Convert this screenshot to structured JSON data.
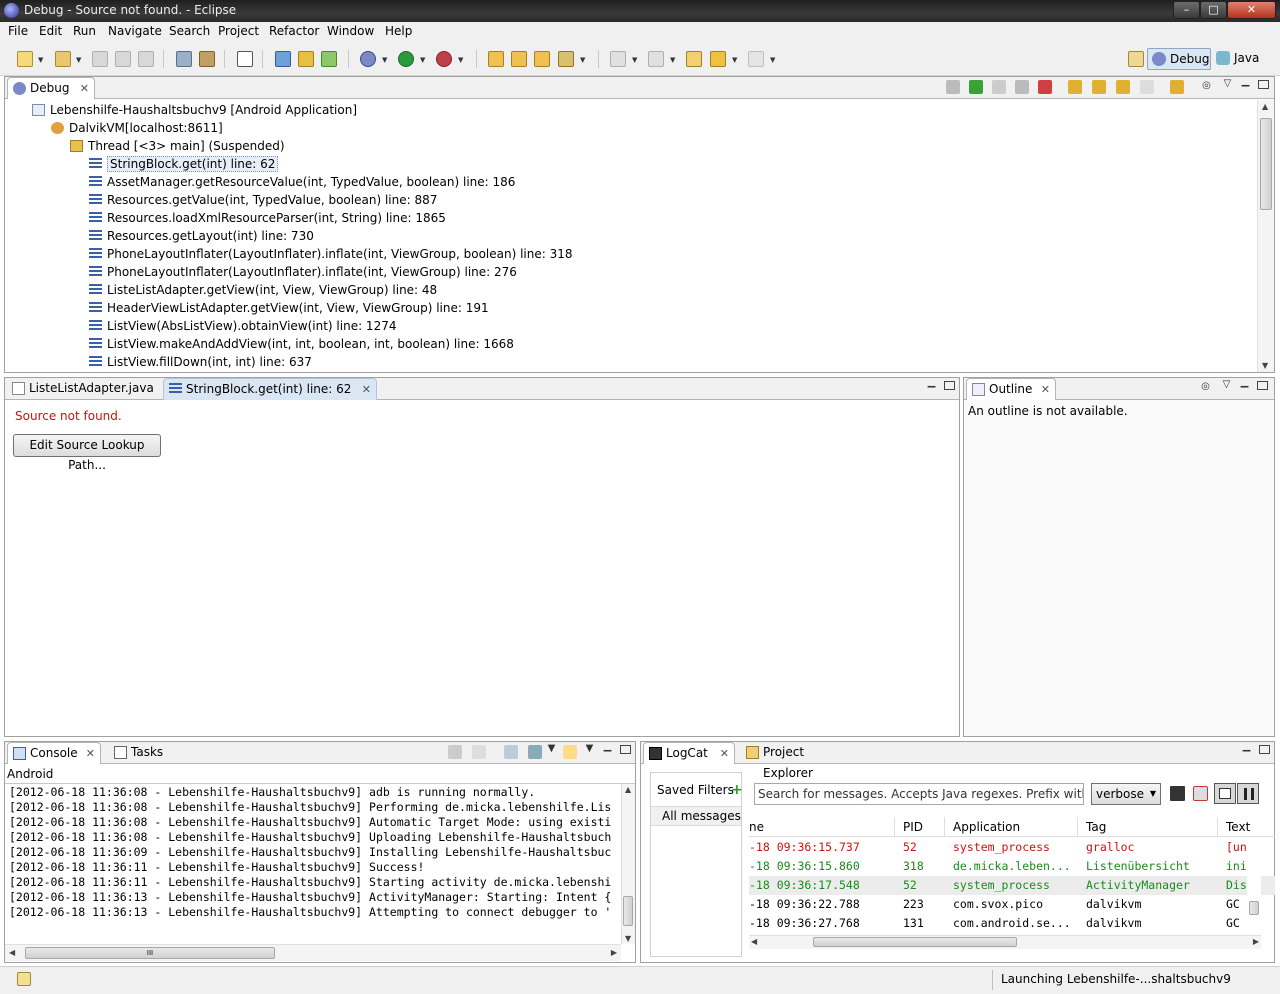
{
  "window": {
    "title": "Debug - Source not found. - Eclipse",
    "min": "–",
    "max": "□",
    "close": "✕"
  },
  "menu": [
    "File",
    "Edit",
    "Run",
    "Navigate",
    "Search",
    "Project",
    "Refactor",
    "Window",
    "Help"
  ],
  "perspectives": {
    "debug": "Debug",
    "java": "Java"
  },
  "debug_view": {
    "tab": "Debug",
    "launch": "Lebenshilfe-Haushaltsbuchv9 [Android Application]",
    "vm": "DalvikVM[localhost:8611]",
    "thread": "Thread [<3> main] (Suspended)",
    "frames": [
      "StringBlock.get(int) line: 62",
      "AssetManager.getResourceValue(int, TypedValue, boolean) line: 186",
      "Resources.getValue(int, TypedValue, boolean) line: 887",
      "Resources.loadXmlResourceParser(int, String) line: 1865",
      "Resources.getLayout(int) line: 730",
      "PhoneLayoutInflater(LayoutInflater).inflate(int, ViewGroup, boolean) line: 318",
      "PhoneLayoutInflater(LayoutInflater).inflate(int, ViewGroup) line: 276",
      "ListeListAdapter.getView(int, View, ViewGroup) line: 48",
      "HeaderViewListAdapter.getView(int, View, ViewGroup) line: 191",
      "ListView(AbsListView).obtainView(int) line: 1274",
      "ListView.makeAndAddView(int, int, boolean, int, boolean) line: 1668",
      "ListView.fillDown(int, int) line: 637"
    ]
  },
  "editor": {
    "tabs": [
      "ListeListAdapter.java",
      "StringBlock.get(int) line: 62"
    ],
    "message": "Source not found.",
    "button": "Edit Source Lookup Path..."
  },
  "outline": {
    "tab": "Outline",
    "message": "An outline is not available."
  },
  "console": {
    "tabs": [
      "Console",
      "Tasks"
    ],
    "label": "Android",
    "lines": [
      "[2012-06-18 11:36:08 - Lebenshilfe-Haushaltsbuchv9] adb is running normally.",
      "[2012-06-18 11:36:08 - Lebenshilfe-Haushaltsbuchv9] Performing de.micka.lebenshilfe.Lis",
      "[2012-06-18 11:36:08 - Lebenshilfe-Haushaltsbuchv9] Automatic Target Mode: using existi",
      "[2012-06-18 11:36:08 - Lebenshilfe-Haushaltsbuchv9] Uploading Lebenshilfe-Haushaltsbuch",
      "[2012-06-18 11:36:09 - Lebenshilfe-Haushaltsbuchv9] Installing Lebenshilfe-Haushaltsbuc",
      "[2012-06-18 11:36:11 - Lebenshilfe-Haushaltsbuchv9] Success!",
      "[2012-06-18 11:36:11 - Lebenshilfe-Haushaltsbuchv9] Starting activity de.micka.lebenshi",
      "[2012-06-18 11:36:13 - Lebenshilfe-Haushaltsbuchv9] ActivityManager: Starting: Intent {",
      "[2012-06-18 11:36:13 - Lebenshilfe-Haushaltsbuchv9] Attempting to connect debugger to '"
    ],
    "hscroll_mark": "III"
  },
  "logcat": {
    "tabs": [
      "LogCat",
      "Project Explorer"
    ],
    "saved_filters": "Saved Filters",
    "all_messages": "All messages (n",
    "search_placeholder": "Search for messages. Accepts Java regexes. Prefix with pid:, app:, tag: or text: to limit scope.",
    "level": "verbose",
    "columns": [
      "ne",
      "PID",
      "Application",
      "Tag",
      "Text"
    ],
    "rows": [
      {
        "time": "-18 09:36:15.737",
        "pid": "52",
        "app": "system_process",
        "tag": "gralloc",
        "text": "[un",
        "color": "#d01010"
      },
      {
        "time": "-18 09:36:15.860",
        "pid": "318",
        "app": "de.micka.leben...",
        "tag": "Listenübersicht",
        "text": "ini",
        "color": "#1a8a1a"
      },
      {
        "time": "-18 09:36:17.548",
        "pid": "52",
        "app": "system_process",
        "tag": "ActivityManager",
        "text": "Dis",
        "color": "#1a8a1a"
      },
      {
        "time": "-18 09:36:22.788",
        "pid": "223",
        "app": "com.svox.pico",
        "tag": "dalvikvm",
        "text": "GC",
        "color": "#000000"
      },
      {
        "time": "-18 09:36:27.768",
        "pid": "131",
        "app": "com.android.se...",
        "tag": "dalvikvm",
        "text": "GC",
        "color": "#000000"
      }
    ]
  },
  "status": {
    "message": "Launching Lebenshilfe-...shaltsbuchv9"
  }
}
